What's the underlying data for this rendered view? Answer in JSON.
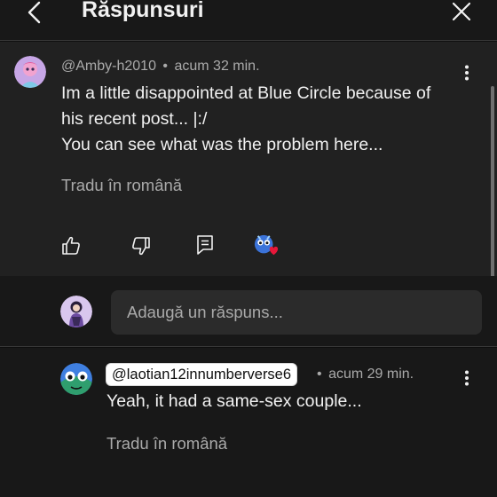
{
  "header": {
    "title": "Răspunsuri",
    "back_icon": "chevron-left-icon",
    "close_icon": "close-icon"
  },
  "parent_comment": {
    "author": "@Amby-h2010",
    "separator": "•",
    "time": "acum 32 min.",
    "line1": "Im a little disappointed at Blue Circle because of",
    "line2": "his recent post... |:/",
    "line3": "You can see what was the problem here...",
    "translate_label": "Tradu în română",
    "actions": [
      "like-icon",
      "dislike-icon",
      "reply-icon",
      "creator-heart-icon"
    ]
  },
  "reply_box": {
    "placeholder": "Adaugă un răspuns..."
  },
  "reply": {
    "mention": "@laotian12innumberverse6",
    "separator": "•",
    "time": "acum 29 min.",
    "text": "Yeah, it had a same-sex couple...",
    "translate_label": "Tradu în română"
  },
  "colors": {
    "background": "#0f0f0f",
    "header": "#181818",
    "parent_bg": "#212121",
    "input_bg": "#2b2b2b",
    "muted_text": "#aaaaaa",
    "text": "#f1f1f1",
    "heart": "#e8173a"
  }
}
